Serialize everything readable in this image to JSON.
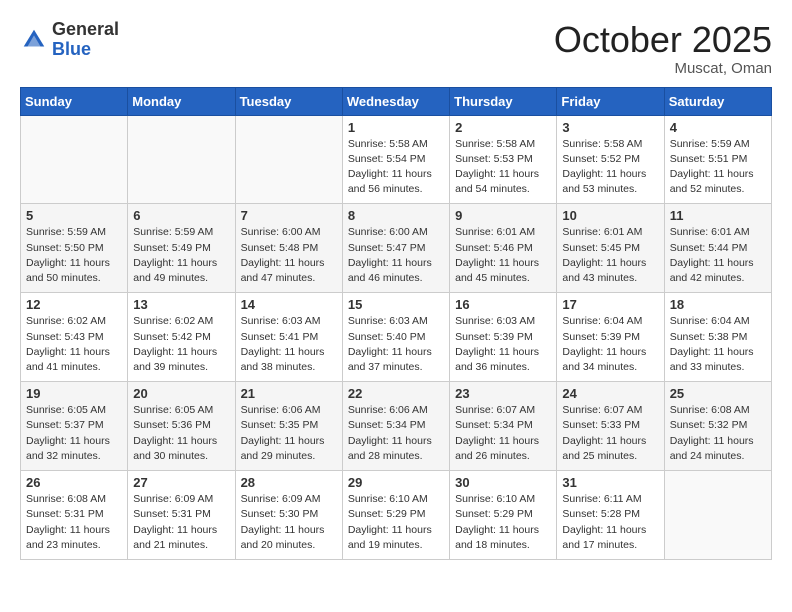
{
  "header": {
    "logo_general": "General",
    "logo_blue": "Blue",
    "month_title": "October 2025",
    "location": "Muscat, Oman"
  },
  "weekdays": [
    "Sunday",
    "Monday",
    "Tuesday",
    "Wednesday",
    "Thursday",
    "Friday",
    "Saturday"
  ],
  "weeks": [
    [
      {
        "day": "",
        "info": ""
      },
      {
        "day": "",
        "info": ""
      },
      {
        "day": "",
        "info": ""
      },
      {
        "day": "1",
        "info": "Sunrise: 5:58 AM\nSunset: 5:54 PM\nDaylight: 11 hours\nand 56 minutes."
      },
      {
        "day": "2",
        "info": "Sunrise: 5:58 AM\nSunset: 5:53 PM\nDaylight: 11 hours\nand 54 minutes."
      },
      {
        "day": "3",
        "info": "Sunrise: 5:58 AM\nSunset: 5:52 PM\nDaylight: 11 hours\nand 53 minutes."
      },
      {
        "day": "4",
        "info": "Sunrise: 5:59 AM\nSunset: 5:51 PM\nDaylight: 11 hours\nand 52 minutes."
      }
    ],
    [
      {
        "day": "5",
        "info": "Sunrise: 5:59 AM\nSunset: 5:50 PM\nDaylight: 11 hours\nand 50 minutes."
      },
      {
        "day": "6",
        "info": "Sunrise: 5:59 AM\nSunset: 5:49 PM\nDaylight: 11 hours\nand 49 minutes."
      },
      {
        "day": "7",
        "info": "Sunrise: 6:00 AM\nSunset: 5:48 PM\nDaylight: 11 hours\nand 47 minutes."
      },
      {
        "day": "8",
        "info": "Sunrise: 6:00 AM\nSunset: 5:47 PM\nDaylight: 11 hours\nand 46 minutes."
      },
      {
        "day": "9",
        "info": "Sunrise: 6:01 AM\nSunset: 5:46 PM\nDaylight: 11 hours\nand 45 minutes."
      },
      {
        "day": "10",
        "info": "Sunrise: 6:01 AM\nSunset: 5:45 PM\nDaylight: 11 hours\nand 43 minutes."
      },
      {
        "day": "11",
        "info": "Sunrise: 6:01 AM\nSunset: 5:44 PM\nDaylight: 11 hours\nand 42 minutes."
      }
    ],
    [
      {
        "day": "12",
        "info": "Sunrise: 6:02 AM\nSunset: 5:43 PM\nDaylight: 11 hours\nand 41 minutes."
      },
      {
        "day": "13",
        "info": "Sunrise: 6:02 AM\nSunset: 5:42 PM\nDaylight: 11 hours\nand 39 minutes."
      },
      {
        "day": "14",
        "info": "Sunrise: 6:03 AM\nSunset: 5:41 PM\nDaylight: 11 hours\nand 38 minutes."
      },
      {
        "day": "15",
        "info": "Sunrise: 6:03 AM\nSunset: 5:40 PM\nDaylight: 11 hours\nand 37 minutes."
      },
      {
        "day": "16",
        "info": "Sunrise: 6:03 AM\nSunset: 5:39 PM\nDaylight: 11 hours\nand 36 minutes."
      },
      {
        "day": "17",
        "info": "Sunrise: 6:04 AM\nSunset: 5:39 PM\nDaylight: 11 hours\nand 34 minutes."
      },
      {
        "day": "18",
        "info": "Sunrise: 6:04 AM\nSunset: 5:38 PM\nDaylight: 11 hours\nand 33 minutes."
      }
    ],
    [
      {
        "day": "19",
        "info": "Sunrise: 6:05 AM\nSunset: 5:37 PM\nDaylight: 11 hours\nand 32 minutes."
      },
      {
        "day": "20",
        "info": "Sunrise: 6:05 AM\nSunset: 5:36 PM\nDaylight: 11 hours\nand 30 minutes."
      },
      {
        "day": "21",
        "info": "Sunrise: 6:06 AM\nSunset: 5:35 PM\nDaylight: 11 hours\nand 29 minutes."
      },
      {
        "day": "22",
        "info": "Sunrise: 6:06 AM\nSunset: 5:34 PM\nDaylight: 11 hours\nand 28 minutes."
      },
      {
        "day": "23",
        "info": "Sunrise: 6:07 AM\nSunset: 5:34 PM\nDaylight: 11 hours\nand 26 minutes."
      },
      {
        "day": "24",
        "info": "Sunrise: 6:07 AM\nSunset: 5:33 PM\nDaylight: 11 hours\nand 25 minutes."
      },
      {
        "day": "25",
        "info": "Sunrise: 6:08 AM\nSunset: 5:32 PM\nDaylight: 11 hours\nand 24 minutes."
      }
    ],
    [
      {
        "day": "26",
        "info": "Sunrise: 6:08 AM\nSunset: 5:31 PM\nDaylight: 11 hours\nand 23 minutes."
      },
      {
        "day": "27",
        "info": "Sunrise: 6:09 AM\nSunset: 5:31 PM\nDaylight: 11 hours\nand 21 minutes."
      },
      {
        "day": "28",
        "info": "Sunrise: 6:09 AM\nSunset: 5:30 PM\nDaylight: 11 hours\nand 20 minutes."
      },
      {
        "day": "29",
        "info": "Sunrise: 6:10 AM\nSunset: 5:29 PM\nDaylight: 11 hours\nand 19 minutes."
      },
      {
        "day": "30",
        "info": "Sunrise: 6:10 AM\nSunset: 5:29 PM\nDaylight: 11 hours\nand 18 minutes."
      },
      {
        "day": "31",
        "info": "Sunrise: 6:11 AM\nSunset: 5:28 PM\nDaylight: 11 hours\nand 17 minutes."
      },
      {
        "day": "",
        "info": ""
      }
    ]
  ]
}
